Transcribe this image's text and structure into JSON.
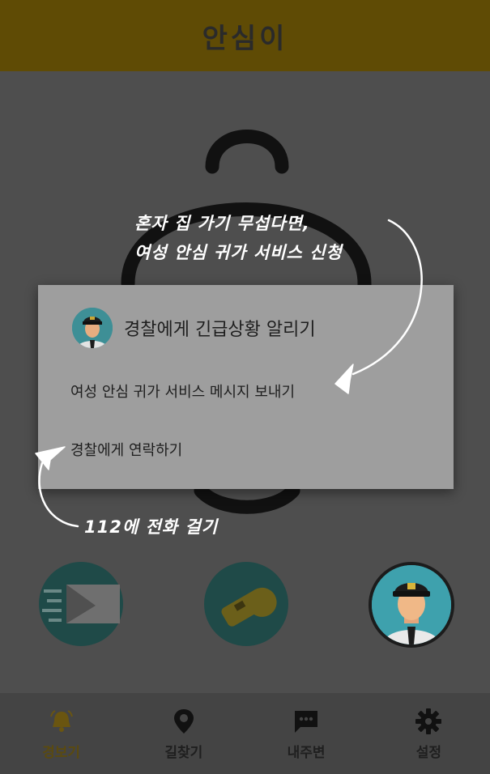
{
  "header": {
    "app_title": "안심이"
  },
  "dialog": {
    "title": "경찰에게 긴급상황 알리기",
    "options": [
      {
        "label": "여성 안심 귀가 서비스 메시지 보내기"
      },
      {
        "label": "경찰에게 연락하기"
      }
    ]
  },
  "annotations": {
    "top_line1": "혼자 집 가기 무섭다면,",
    "top_line2": "여성 안심 귀가 서비스 신청",
    "bottom": "112에 전화 걸기"
  },
  "bottom_nav": {
    "items": [
      {
        "label": "경보기",
        "icon": "bell-icon",
        "active": true
      },
      {
        "label": "길찾기",
        "icon": "location-pin-icon",
        "active": false
      },
      {
        "label": "내주변",
        "icon": "chat-bubble-icon",
        "active": false
      },
      {
        "label": "설정",
        "icon": "gear-icon",
        "active": false
      }
    ]
  },
  "colors": {
    "header_bg": "#5f4b05",
    "dialog_bg": "#9e9e9e",
    "action_teal": "#1f4a48",
    "police_circle": "#3ea1ad",
    "active_nav": "#5a4a10"
  }
}
